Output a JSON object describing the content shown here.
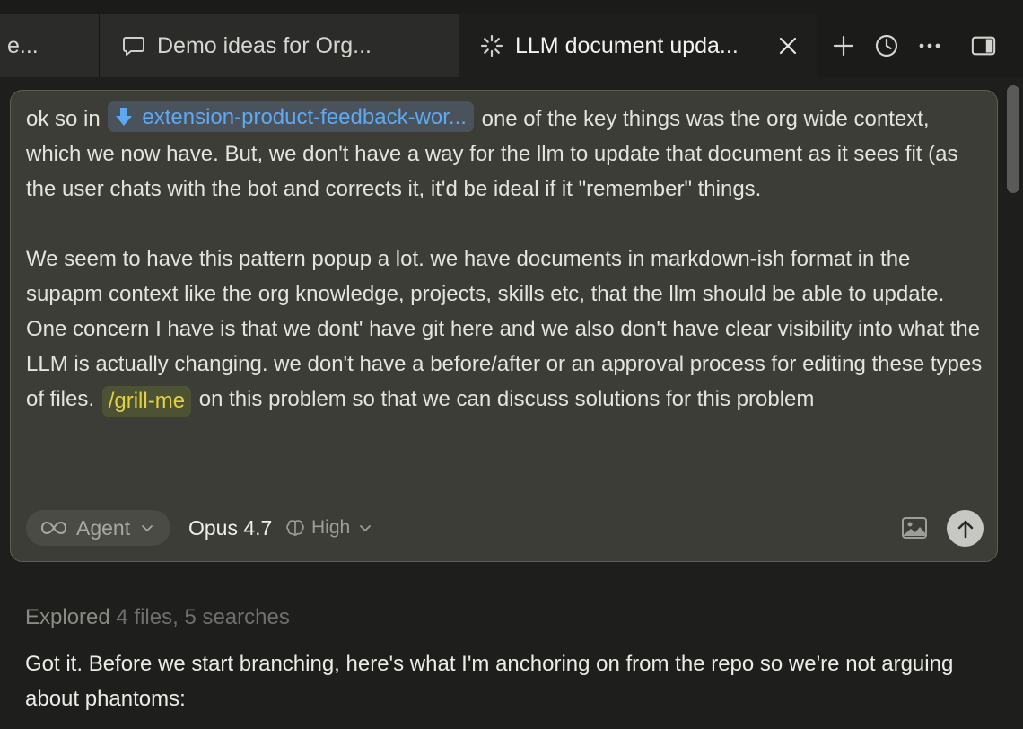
{
  "tabs": [
    {
      "label": "e...",
      "icon": "none",
      "active": false
    },
    {
      "label": "Demo ideas for Org...",
      "icon": "chat-bubble-icon",
      "active": false
    },
    {
      "label": "LLM document upda...",
      "icon": "loading-spinner-icon",
      "active": true
    }
  ],
  "tab_actions": [
    "plus-icon",
    "history-clock-icon",
    "more-ellipsis-icon",
    "toggle-sidebar-icon"
  ],
  "composer": {
    "prompt": {
      "p1_before": "ok so in ",
      "file_ref": "extension-product-feedback-wor...",
      "p1_after": " one of the key things was the org wide context, which we now have. But, we don't have a way for the llm to update that document as it sees fit (as the user chats with the bot and corrects it, it'd be ideal if it \"remember\" things.",
      "p2_before": "We seem to have this pattern popup a lot. we have documents in markdown-ish format in the supapm context like the org knowledge, projects, skills etc, that the llm should be able to update. One concern I have is that we dont' have git here and we also don't have clear visibility into what the LLM is actually changing. we don't have a before/after or an approval process for editing these types of files. ",
      "command": "/grill-me",
      "p2_after": " on this problem so that we can discuss solutions for this problem"
    },
    "mode_label": "Agent",
    "model_label": "Opus 4.7",
    "effort_label": "High"
  },
  "conversation": {
    "explored_label": "Explored",
    "explored_count": "4 files, 5 searches",
    "answer_text": "Got it. Before we start branching, here's what I'm anchoring on from the repo so we're not arguing about phantoms:"
  },
  "colors": {
    "accent_link": "#5fa8f2",
    "command_chip": "#e2d040",
    "composer_bg": "#3c3d37"
  }
}
